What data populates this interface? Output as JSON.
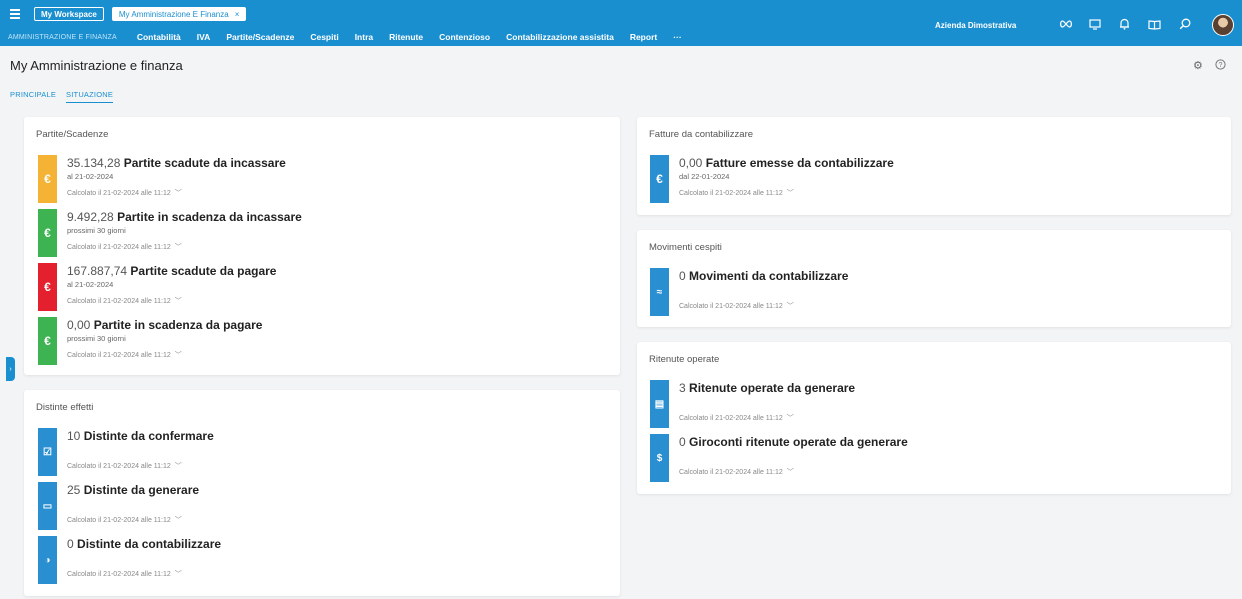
{
  "topbar": {
    "workspace_tab": "My Workspace",
    "module_tab": "My Amministrazione E Finanza",
    "close_glyph": "×",
    "app_name": "AMMINISTRAZIONE E FINANZA",
    "menu": [
      "Contabilità",
      "IVA",
      "Partite/Scadenze",
      "Cespiti",
      "Intra",
      "Ritenute",
      "Contenzioso",
      "Contabilizzazione assistita",
      "Report",
      "···"
    ],
    "company": "Azienda Dimostrativa",
    "icons": [
      "infinity-icon",
      "monitor-icon",
      "bell-icon",
      "book-icon",
      "search-icon",
      "avatar"
    ],
    "accent": "#1a8fd0"
  },
  "page": {
    "title": "My Amministrazione e finanza",
    "tabs": [
      "PRINCIPALE",
      "SITUAZIONE"
    ],
    "active_tab": "SITUAZIONE"
  },
  "partite": {
    "title": "Partite/Scadenze",
    "items": [
      {
        "value": "35.134,28",
        "label": "Partite scadute da incassare",
        "sub": "al 21-02-2024",
        "calc": "Calcolato il 21-02-2024 alle 11:12",
        "color": "#f5b335",
        "icon": "€"
      },
      {
        "value": "9.492,28",
        "label": "Partite in scadenza da incassare",
        "sub": "prossimi 30 giorni",
        "calc": "Calcolato il 21-02-2024 alle 11:12",
        "color": "#3db351",
        "icon": "€"
      },
      {
        "value": "167.887,74",
        "label": "Partite scadute da pagare",
        "sub": "al 21-02-2024",
        "calc": "Calcolato il 21-02-2024 alle 11:12",
        "color": "#e5202e",
        "icon": "€"
      },
      {
        "value": "0,00",
        "label": "Partite in scadenza da pagare",
        "sub": "prossimi 30 giorni",
        "calc": "Calcolato il 21-02-2024 alle 11:12",
        "color": "#3db351",
        "icon": "€"
      }
    ]
  },
  "distinte": {
    "title": "Distinte effetti",
    "items": [
      {
        "value": "10",
        "label": "Distinte da confermare",
        "calc": "Calcolato il 21-02-2024 alle 11:12",
        "color": "#2a8fd0",
        "icon": "☑"
      },
      {
        "value": "25",
        "label": "Distinte da generare",
        "calc": "Calcolato il 21-02-2024 alle 11:12",
        "color": "#2a8fd0",
        "icon": "▭"
      },
      {
        "value": "0",
        "label": "Distinte da contabilizzare",
        "calc": "Calcolato il 21-02-2024 alle 11:12",
        "color": "#2a8fd0",
        "icon": "◑"
      }
    ]
  },
  "fatture": {
    "title": "Fatture da contabilizzare",
    "items": [
      {
        "value": "0,00",
        "label": "Fatture emesse da contabilizzare",
        "sub": "dal 22-01-2024",
        "calc": "Calcolato il 21-02-2024 alle 11:12",
        "color": "#2a8fd0",
        "icon": "€"
      }
    ]
  },
  "cespiti": {
    "title": "Movimenti cespiti",
    "items": [
      {
        "value": "0",
        "label": "Movimenti da contabilizzare",
        "calc": "Calcolato il 21-02-2024 alle 11:12",
        "color": "#2a8fd0",
        "icon": "≈"
      }
    ]
  },
  "ritenute": {
    "title": "Ritenute operate",
    "items": [
      {
        "value": "3",
        "label": "Ritenute operate da generare",
        "calc": "Calcolato il 21-02-2024 alle 11:12",
        "color": "#2a8fd0",
        "icon": "▤"
      },
      {
        "value": "0",
        "label": "Giroconti ritenute operate da generare",
        "calc": "Calcolato il 21-02-2024 alle 11:12",
        "color": "#2a8fd0",
        "icon": "$"
      }
    ]
  },
  "chevron": "﹀"
}
